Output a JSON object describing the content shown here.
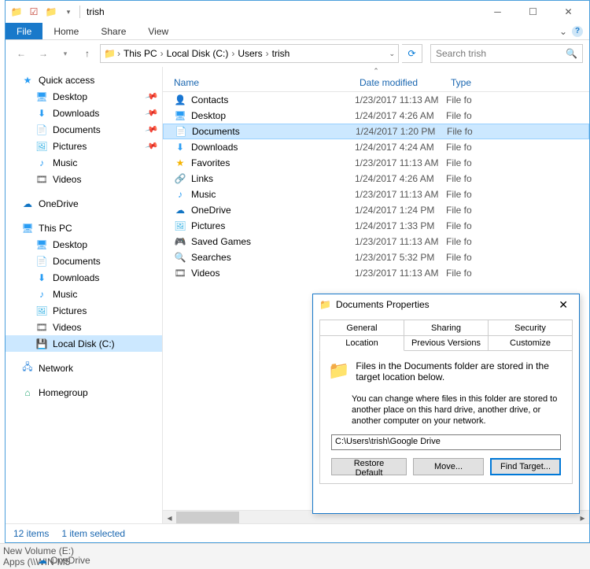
{
  "window": {
    "title": "trish"
  },
  "ribbon": {
    "file": "File",
    "tabs": [
      "Home",
      "Share",
      "View"
    ]
  },
  "breadcrumb": [
    "This PC",
    "Local Disk (C:)",
    "Users",
    "trish"
  ],
  "search": {
    "placeholder": "Search trish"
  },
  "sidebar": {
    "quick": {
      "label": "Quick access",
      "items": [
        {
          "label": "Desktop",
          "icon": "desktop",
          "pinned": true
        },
        {
          "label": "Downloads",
          "icon": "downloads",
          "pinned": true
        },
        {
          "label": "Documents",
          "icon": "documents",
          "pinned": true
        },
        {
          "label": "Pictures",
          "icon": "pictures",
          "pinned": true
        },
        {
          "label": "Music",
          "icon": "music",
          "pinned": false
        },
        {
          "label": "Videos",
          "icon": "videos",
          "pinned": false
        }
      ]
    },
    "onedrive": {
      "label": "OneDrive"
    },
    "thispc": {
      "label": "This PC",
      "items": [
        {
          "label": "Desktop",
          "icon": "desktop"
        },
        {
          "label": "Documents",
          "icon": "documents"
        },
        {
          "label": "Downloads",
          "icon": "downloads"
        },
        {
          "label": "Music",
          "icon": "music"
        },
        {
          "label": "Pictures",
          "icon": "pictures"
        },
        {
          "label": "Videos",
          "icon": "videos"
        },
        {
          "label": "Local Disk (C:)",
          "icon": "disk",
          "selected": true
        }
      ]
    },
    "network": {
      "label": "Network"
    },
    "homegroup": {
      "label": "Homegroup"
    }
  },
  "columns": {
    "name": "Name",
    "date": "Date modified",
    "type": "Type"
  },
  "files": [
    {
      "name": "Contacts",
      "icon": "contacts",
      "date": "1/23/2017 11:13 AM",
      "type": "File folder"
    },
    {
      "name": "Desktop",
      "icon": "desktop",
      "date": "1/24/2017 4:26 AM",
      "type": "File folder"
    },
    {
      "name": "Documents",
      "icon": "documents",
      "date": "1/24/2017 1:20 PM",
      "type": "File folder",
      "selected": true
    },
    {
      "name": "Downloads",
      "icon": "downloads",
      "date": "1/24/2017 4:24 AM",
      "type": "File folder"
    },
    {
      "name": "Favorites",
      "icon": "favorites",
      "date": "1/23/2017 11:13 AM",
      "type": "File folder"
    },
    {
      "name": "Links",
      "icon": "links",
      "date": "1/24/2017 4:26 AM",
      "type": "File folder"
    },
    {
      "name": "Music",
      "icon": "music",
      "date": "1/23/2017 11:13 AM",
      "type": "File folder"
    },
    {
      "name": "OneDrive",
      "icon": "onedrive",
      "date": "1/24/2017 1:24 PM",
      "type": "File folder"
    },
    {
      "name": "Pictures",
      "icon": "pictures",
      "date": "1/24/2017 1:33 PM",
      "type": "File folder"
    },
    {
      "name": "Saved Games",
      "icon": "savedgames",
      "date": "1/23/2017 11:13 AM",
      "type": "File folder"
    },
    {
      "name": "Searches",
      "icon": "searches",
      "date": "1/23/2017 5:32 PM",
      "type": "File folder"
    },
    {
      "name": "Videos",
      "icon": "videos",
      "date": "1/23/2017 11:13 AM",
      "type": "File folder"
    }
  ],
  "status": {
    "count": "12 items",
    "selected": "1 item selected"
  },
  "dialog": {
    "title": "Documents Properties",
    "tabs_row1": [
      "General",
      "Sharing",
      "Security"
    ],
    "tabs_row2": [
      "Location",
      "Previous Versions",
      "Customize"
    ],
    "active_tab": "Location",
    "info": "Files in the Documents folder are stored in the target location below.",
    "desc": "You can change where files in this folder are stored to another place on this hard drive, another drive, or another computer on your network.",
    "path": "C:\\Users\\trish\\Google Drive",
    "buttons": {
      "restore": "Restore Default",
      "move": "Move...",
      "find": "Find Target..."
    }
  },
  "bg": {
    "line1": "New Volume (E:)",
    "line2": "Apps (\\\\WIN-M5",
    "onedrive": "OneDrive"
  }
}
